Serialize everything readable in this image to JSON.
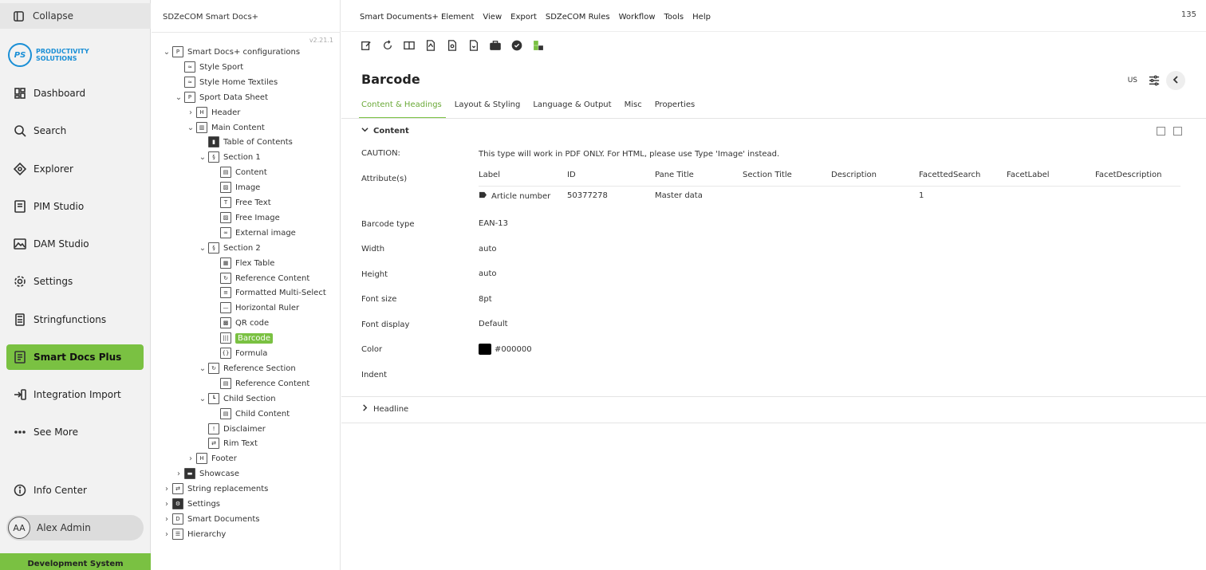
{
  "nav": {
    "collapse": "Collapse",
    "logo_mark": "PS",
    "logo_text": "PRODUCTIVITY SOLUTIONS",
    "items": [
      {
        "label": "Dashboard",
        "icon": "dashboard-icon"
      },
      {
        "label": "Search",
        "icon": "search-icon"
      },
      {
        "label": "Explorer",
        "icon": "explorer-icon"
      },
      {
        "label": "PIM Studio",
        "icon": "pim-icon"
      },
      {
        "label": "DAM Studio",
        "icon": "image-icon"
      },
      {
        "label": "Settings",
        "icon": "gear-icon"
      },
      {
        "label": "Stringfunctions",
        "icon": "calculator-icon"
      },
      {
        "label": "Smart Docs Plus",
        "icon": "document-icon",
        "active": true
      },
      {
        "label": "Integration Import",
        "icon": "import-icon"
      },
      {
        "label": "See More",
        "icon": "more-icon"
      },
      {
        "label": "Info Center",
        "icon": "info-icon"
      }
    ],
    "user_initials": "AA",
    "user_name": "Alex Admin",
    "env_banner": "Development System",
    "accent": "#7ac142"
  },
  "tree": {
    "title": "SDZeCOM Smart Docs+",
    "version": "v2.21.1",
    "nodes": [
      {
        "label": "Smart Docs+ configurations",
        "toggle": "expanded",
        "icon": "pdf"
      },
      {
        "label": "Style Sport",
        "icon": "style"
      },
      {
        "label": "Style Home Textiles",
        "icon": "style"
      },
      {
        "label": "Sport Data Sheet",
        "toggle": "expanded",
        "icon": "pdf"
      },
      {
        "label": "Header",
        "toggle": "collapsed",
        "icon": "header"
      },
      {
        "label": "Main Content",
        "toggle": "expanded",
        "icon": "columns"
      },
      {
        "label": "Table of Contents",
        "icon": "bookmark"
      },
      {
        "label": "Section 1",
        "toggle": "expanded",
        "icon": "section"
      },
      {
        "label": "Content",
        "icon": "content"
      },
      {
        "label": "Image",
        "icon": "image"
      },
      {
        "label": "Free Text",
        "icon": "text"
      },
      {
        "label": "Free Image",
        "icon": "image"
      },
      {
        "label": "External image",
        "icon": "link"
      },
      {
        "label": "Section 2",
        "toggle": "expanded",
        "icon": "section"
      },
      {
        "label": "Flex Table",
        "icon": "table"
      },
      {
        "label": "Reference Content",
        "icon": "reference"
      },
      {
        "label": "Formatted Multi-Select",
        "icon": "list"
      },
      {
        "label": "Horizontal Ruler",
        "icon": "ruler"
      },
      {
        "label": "QR code",
        "icon": "qr"
      },
      {
        "label": "Barcode",
        "icon": "barcode",
        "selected": true
      },
      {
        "label": "Formula",
        "icon": "formula"
      },
      {
        "label": "Reference Section",
        "toggle": "expanded",
        "icon": "reference"
      },
      {
        "label": "Reference Content",
        "icon": "content"
      },
      {
        "label": "Child Section",
        "toggle": "expanded",
        "icon": "child"
      },
      {
        "label": "Child Content",
        "icon": "content"
      },
      {
        "label": "Disclaimer",
        "icon": "disclaimer"
      },
      {
        "label": "Rim Text",
        "icon": "rim"
      },
      {
        "label": "Footer",
        "toggle": "collapsed",
        "icon": "header"
      },
      {
        "label": "Showcase",
        "toggle": "collapsed",
        "icon": "folder"
      },
      {
        "label": "String replacements",
        "toggle": "collapsed",
        "icon": "swap"
      },
      {
        "label": "Settings",
        "toggle": "collapsed",
        "icon": "gear"
      },
      {
        "label": "Smart Documents",
        "toggle": "collapsed",
        "icon": "doc"
      },
      {
        "label": "Hierarchy",
        "toggle": "collapsed",
        "icon": "db"
      }
    ]
  },
  "menubar": {
    "items": [
      "Smart Documents+ Element",
      "View",
      "Export",
      "SDZeCOM Rules",
      "Workflow",
      "Tools",
      "Help"
    ],
    "count": "135"
  },
  "page": {
    "title": "Barcode",
    "locale": "US",
    "tabs": [
      "Content & Headings",
      "Layout & Styling",
      "Language & Output",
      "Misc",
      "Properties"
    ],
    "active_tab": 0
  },
  "content": {
    "section_label": "Content",
    "caution_label": "CAUTION:",
    "caution_text": "This type will work in PDF ONLY. For HTML, please use Type 'Image' instead.",
    "attributes_label": "Attribute(s)",
    "attr_headers": [
      "Label",
      "ID",
      "Pane Title",
      "Section Title",
      "Description",
      "FacettedSearch",
      "FacetLabel",
      "FacetDescription"
    ],
    "attr_row": {
      "label": "Article number",
      "id": "50377278",
      "pane_title": "Master data",
      "section_title": "",
      "description": "",
      "facetted_search": "1",
      "facet_label": "",
      "facet_description": ""
    },
    "fields": [
      {
        "label": "Barcode type",
        "value": "EAN-13"
      },
      {
        "label": "Width",
        "value": "auto"
      },
      {
        "label": "Height",
        "value": "auto"
      },
      {
        "label": "Font size",
        "value": "8pt"
      },
      {
        "label": "Font display",
        "value": "Default"
      },
      {
        "label": "Color",
        "value": "#000000",
        "swatch": "#000000"
      },
      {
        "label": "Indent",
        "value": ""
      }
    ],
    "headline_label": "Headline"
  }
}
